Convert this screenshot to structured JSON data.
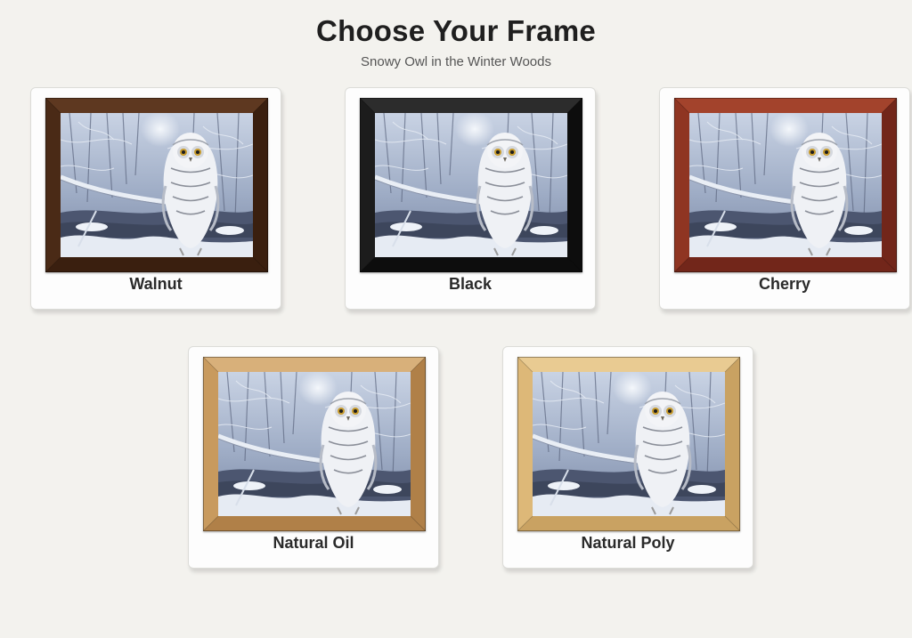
{
  "header": {
    "title": "Choose Your Frame",
    "subtitle": "Snowy Owl in the Winter Woods"
  },
  "frames": [
    {
      "label": "Walnut",
      "color": "#4a2a16",
      "light": "#5e3820",
      "dark": "#3a1f0f"
    },
    {
      "label": "Black",
      "color": "#1c1c1c",
      "light": "#2c2c2c",
      "dark": "#0d0d0d"
    },
    {
      "label": "Cherry",
      "color": "#8f3522",
      "light": "#a3432c",
      "dark": "#72261a"
    },
    {
      "label": "Natural Oil",
      "color": "#c89a5e",
      "light": "#d8b07a",
      "dark": "#b08048"
    },
    {
      "label": "Natural Poly",
      "color": "#ddb878",
      "light": "#e9cb92",
      "dark": "#c9a262"
    }
  ]
}
